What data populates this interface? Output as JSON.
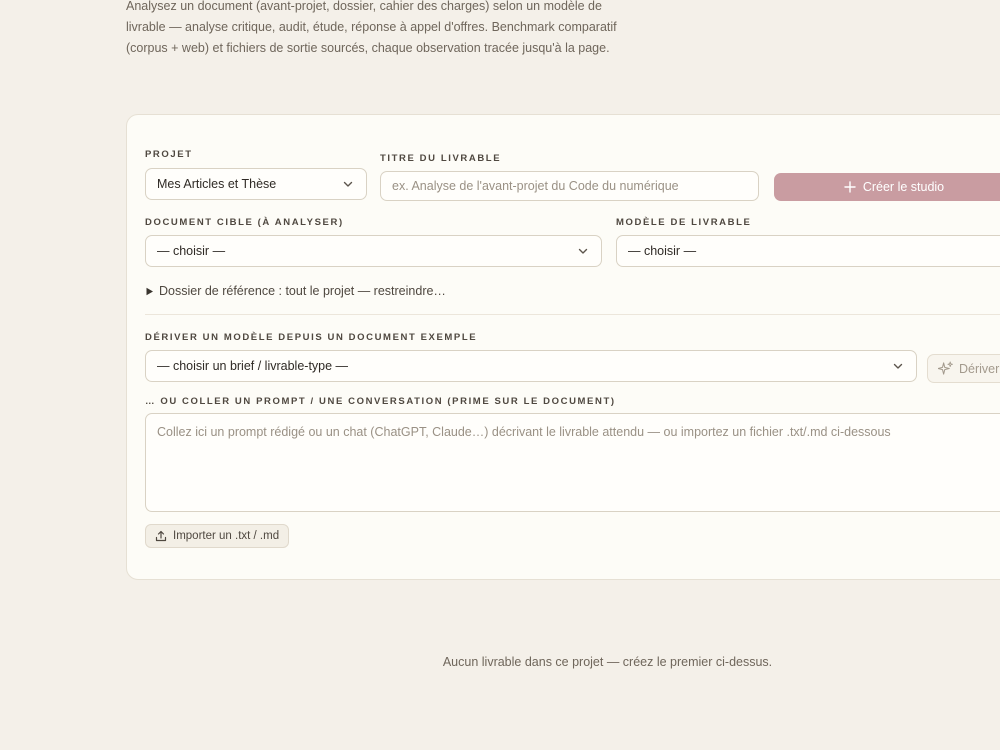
{
  "intro": "Analysez un document (avant-projet, dossier, cahier des charges) selon un modèle de livrable — analyse critique, audit, étude, réponse à appel d'offres. Benchmark comparatif (corpus + web) et fichiers de sortie sourcés, chaque observation tracée jusqu'à la page.",
  "form": {
    "project_label": "PROJET",
    "project_value": "Mes Articles et Thèse",
    "title_label": "TITRE DU LIVRABLE",
    "title_placeholder": "ex. Analyse de l'avant-projet du Code du numérique",
    "create_button": "Créer le studio",
    "target_label": "DOCUMENT CIBLE (À ANALYSER)",
    "target_value": "— choisir —",
    "model_label": "MODÈLE DE LIVRABLE",
    "model_value": "— choisir —",
    "reference_toggle": "Dossier de référence : tout le projet — restreindre…",
    "derive_label": "DÉRIVER UN MODÈLE DEPUIS UN DOCUMENT EXEMPLE",
    "derive_value": "— choisir un brief / livrable-type —",
    "derive_button": "Dériver",
    "paste_label": "… OU COLLER UN PROMPT / UNE CONVERSATION (PRIME SUR LE DOCUMENT)",
    "paste_placeholder": "Collez ici un prompt rédigé ou un chat (ChatGPT, Claude…) décrivant le livrable attendu — ou importez un fichier .txt/.md ci-dessous",
    "import_button": "Importer un .txt / .md"
  },
  "empty_state": "Aucun livrable dans ce projet — créez le premier ci-dessus.",
  "icons": {
    "chevron": "chevron-down-icon",
    "plus": "plus-icon",
    "sparkle": "sparkle-icon",
    "upload": "upload-icon",
    "disclosure": "triangle-right-icon"
  },
  "colors": {
    "background": "#f4f0e9",
    "card": "#fdfcf7",
    "accent": "#c99ca1"
  }
}
